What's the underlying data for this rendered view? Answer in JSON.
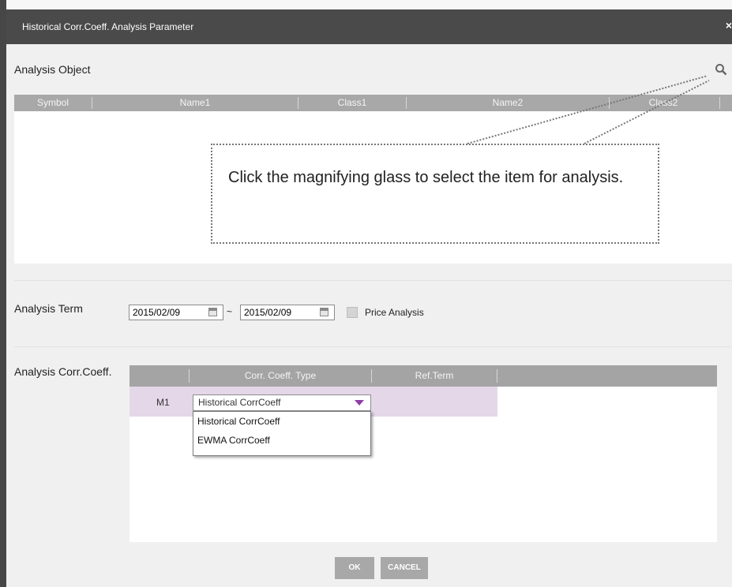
{
  "window": {
    "title": "Historical Corr.Coeff. Analysis Parameter",
    "close_glyph": "×"
  },
  "analysis_object": {
    "label": "Analysis Object",
    "columns": [
      "Symbol",
      "Name1",
      "Class1",
      "Name2",
      "Class2"
    ]
  },
  "analysis_term": {
    "label": "Analysis Term",
    "start_date": "2015/02/09",
    "separator": "~",
    "end_date": "2015/02/09",
    "price_analysis_label": "Price Analysis",
    "price_analysis_checked": false
  },
  "corr_coeff": {
    "label": "Analysis Corr.Coeff.",
    "columns": [
      "",
      "Corr. Coeff. Type",
      "Ref.Term",
      ""
    ],
    "rows": [
      {
        "id": "M1",
        "type": "Historical CorrCoeff",
        "ref_term": ""
      }
    ],
    "dropdown_options": [
      "Historical CorrCoeff",
      "EWMA CorrCoeff"
    ]
  },
  "buttons": {
    "ok": "OK",
    "cancel": "CANCEL"
  },
  "callout": {
    "text": "Click the magnifying glass to select the item for analysis."
  },
  "colors": {
    "title_bar": "#4a4a4a",
    "grid_header": "#a8a8a8",
    "row_highlight": "#e4d7e8",
    "dropdown_arrow": "#8e3ea6"
  }
}
